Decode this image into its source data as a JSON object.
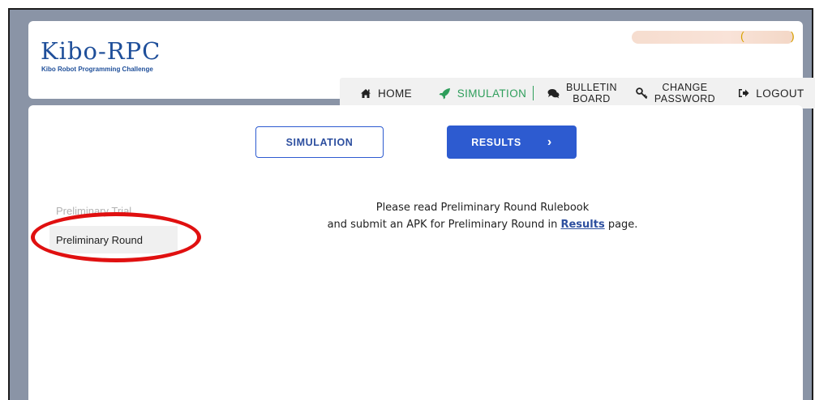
{
  "app": {
    "logo_title": "Kibo-RPC",
    "logo_subtitle": "Kibo Robot Programming Challenge",
    "user_paren_open": "(",
    "user_paren_close": ")"
  },
  "nav": {
    "items": [
      {
        "label": "HOME",
        "icon": "home-icon",
        "active": false
      },
      {
        "label": "SIMULATION",
        "icon": "rocket-icon",
        "active": true
      },
      {
        "label_line1": "BULLETIN",
        "label_line2": "BOARD",
        "icon": "comments-icon",
        "active": false
      },
      {
        "label_line1": "CHANGE",
        "label_line2": "PASSWORD",
        "icon": "key-icon",
        "active": false
      },
      {
        "label": "LOGOUT",
        "icon": "logout-icon",
        "active": false
      }
    ]
  },
  "tabs": {
    "simulation_label": "SIMULATION",
    "results_label": "RESULTS",
    "results_arrow": "›"
  },
  "sidebar": {
    "items": [
      {
        "label": "Preliminary Trial",
        "active": false
      },
      {
        "label": "Preliminary Round",
        "active": true
      }
    ]
  },
  "message": {
    "line1": "Please read Preliminary Round Rulebook",
    "line2_before": "and submit an APK for Preliminary Round in ",
    "link": "Results",
    "line2_after": " page."
  },
  "colors": {
    "accent_blue": "#2d5bd0",
    "active_green": "#2e9e5b",
    "annotation_red": "#e01010",
    "background_gray": "#8a94a6"
  }
}
